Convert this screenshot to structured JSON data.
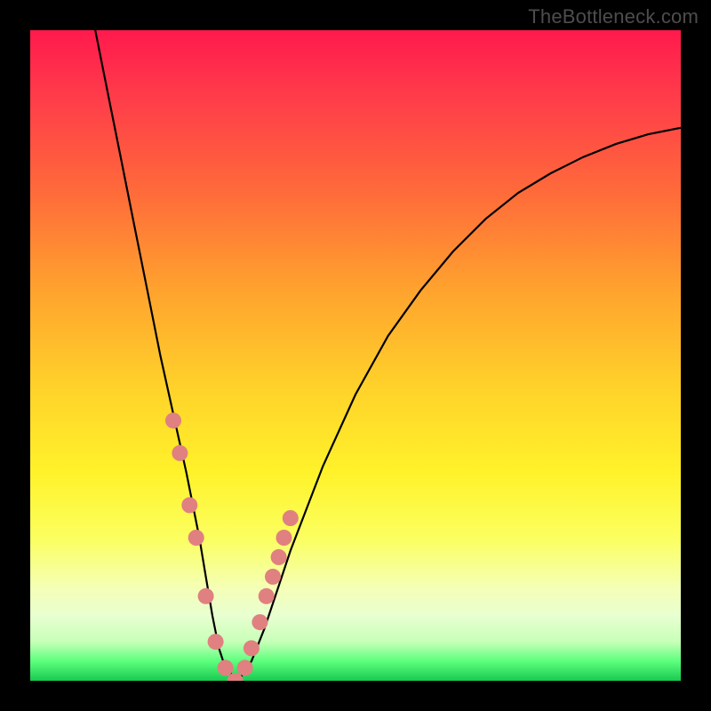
{
  "watermark": "TheBottleneck.com",
  "chart_data": {
    "type": "line",
    "title": "",
    "xlabel": "",
    "ylabel": "",
    "xlim": [
      0,
      100
    ],
    "ylim": [
      0,
      100
    ],
    "series": [
      {
        "name": "bottleneck-curve",
        "x": [
          10,
          12,
          14,
          16,
          18,
          20,
          22,
          24,
          26,
          27,
          28,
          29,
          30,
          32,
          34,
          36,
          38,
          40,
          45,
          50,
          55,
          60,
          65,
          70,
          75,
          80,
          85,
          90,
          95,
          100
        ],
        "y": [
          100,
          90,
          80,
          70,
          60,
          50,
          41,
          32,
          22,
          16,
          10,
          5,
          2,
          0,
          3,
          8,
          14,
          20,
          33,
          44,
          53,
          60,
          66,
          71,
          75,
          78,
          80.5,
          82.5,
          84,
          85
        ]
      }
    ],
    "markers": {
      "name": "highlight-dots",
      "color": "#e08080",
      "x": [
        22,
        23,
        24.5,
        25.5,
        27,
        28.5,
        30,
        31.5,
        33,
        34,
        35.3,
        36.3,
        37.3,
        38.2,
        39,
        40
      ],
      "y": [
        40,
        35,
        27,
        22,
        13,
        6,
        2,
        0,
        2,
        5,
        9,
        13,
        16,
        19,
        22,
        25
      ]
    }
  }
}
